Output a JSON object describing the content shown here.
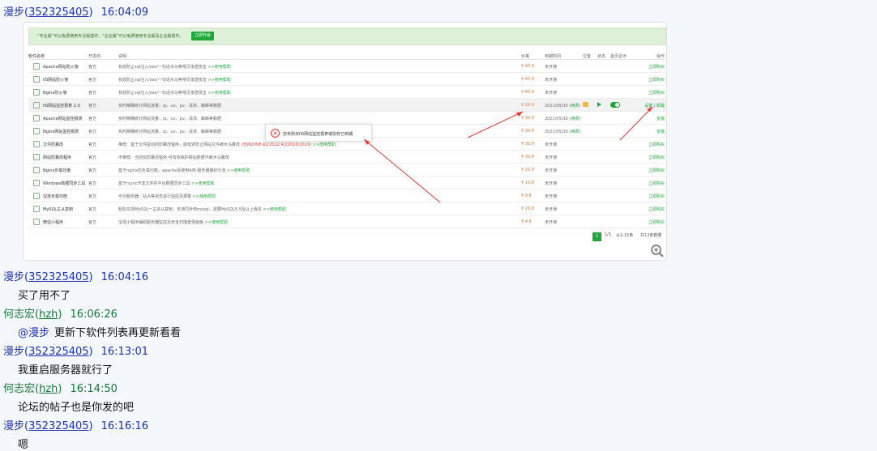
{
  "messages": [
    {
      "user": "漫步",
      "uid": "352325405",
      "time": "16:04:09",
      "color": "#1c31b6",
      "kind": "image"
    },
    {
      "user": "漫步",
      "uid": "352325405",
      "time": "16:04:16",
      "color": "#1c31b6",
      "text": "买了用不了"
    },
    {
      "user": "何志宏",
      "uid": "hzh",
      "time": "16:06:26",
      "color": "#157a35",
      "mention": "@漫步",
      "text": "更新下软件列表再更新看看"
    },
    {
      "user": "漫步",
      "uid": "352325405",
      "time": "16:13:01",
      "color": "#1c31b6",
      "text": "我重启服务器就行了"
    },
    {
      "user": "何志宏",
      "uid": "hzh",
      "time": "16:14:50",
      "color": "#157a35",
      "text": "论坛的帖子也是你发的吧"
    },
    {
      "user": "漫步",
      "uid": "352325405",
      "time": "16:16:16",
      "color": "#1c31b6",
      "text": "嗯"
    }
  ],
  "shot": {
    "banner": "“专业版”可以免费使用专业版插件，“企业版”可以免费使用专业版及企业版插件。",
    "banner_button": "立即升级",
    "headers": {
      "name": "软件名称",
      "dev": "开发商",
      "desc": "说明",
      "price": "价格",
      "expire": "到期时间",
      "pos": "位置",
      "status": "状态",
      "home": "首页显示",
      "op": "操作"
    },
    "rows": [
      {
        "name": "Apache网站防火墙",
        "dev": "官方",
        "desc": "有效防止sql注入/xss/一句话木马等常见渗透攻击",
        "more": ">>使用帮助",
        "price": "¥ 40.0",
        "expire": "未开通",
        "op": "立即购买"
      },
      {
        "name": "IIS网站防火墙",
        "dev": "官方",
        "desc": "有效防止sql注入/xss/一句话木马等常见渗透攻击",
        "more": ">>使用帮助",
        "price": "¥ 40.0",
        "expire": "未开通",
        "op": "立即购买"
      },
      {
        "name": "Nginx防火墙",
        "dev": "官方",
        "desc": "有效防止sql注入/xss/一句话木马等常见渗透攻击",
        "more": ">>使用帮助",
        "price": "¥ 40.0",
        "expire": "未开通",
        "op": "立即购买"
      },
      {
        "name": "IIS网站监控报表 2.0",
        "dev": "官方",
        "desc": "实时精确统计网站流量、ip、uv、pv、请求、蜘蛛等数据",
        "price": "¥ 20.0",
        "expire": "2021/05/30",
        "expire_link": "(续费)",
        "op": "设置 | 卸载",
        "highlight": true
      },
      {
        "name": "Apache网站监控报表",
        "dev": "官方",
        "desc": "实时精确统计网站流量、ip、uv、pv、请求、蜘蛛等数据",
        "price": "¥ 30.0",
        "expire": "2021/05/30",
        "expire_link": "(续费)",
        "op": "安装"
      },
      {
        "name": "Nginx网站监控报表",
        "dev": "官方",
        "desc": "实时精确统计网站流量、ip、uv、pv、请求、蜘蛛等数据",
        "price": "¥ 30.0",
        "expire": "2021/05/30",
        "expire_link": "(续费)",
        "op": "安装"
      },
      {
        "name": "文件防篡改",
        "dev": "官方",
        "desc": "推荐：基于文件驱动的防篡改程序，能有效防止网站文件被木马篡改",
        "red": "(支持2008 R2/2012 R2/2016/2019)",
        "more": ">>使用帮助",
        "price": "¥ 30.0",
        "expire": "未开通",
        "op": "立即购买"
      },
      {
        "name": "网站防篡改程序",
        "dev": "官方",
        "desc": "不推荐：当前仅防篡改程序,可有效保护网站数据不被木马篡改",
        "price": "¥ 30.0",
        "expire": "未开通",
        "op": "立即购买"
      },
      {
        "name": "Nginx负载均衡",
        "dev": "官方",
        "desc": "基于nginx的负载均衡，apache请使用A/B 服务器做好分流",
        "more": ">>使用帮助",
        "price": "¥ 20.0",
        "expire": "未开通",
        "op": "立即购买"
      },
      {
        "name": "Windows数据同步工具",
        "dev": "官方",
        "desc": "基于rsync开发文件的平台数据同步工具",
        "more": ">>使用帮助",
        "price": "¥ 15.0",
        "expire": "未开通",
        "op": "立即购买"
      },
      {
        "name": "宝塔负载均衡",
        "dev": "官方",
        "desc": "可对服务器、站点等状态进行监控及报警",
        "more": ">>使用帮助",
        "price": "¥ 9.8",
        "expire": "未开通",
        "op": "立即购买"
      },
      {
        "name": "MySQL主从复制",
        "dev": "官方",
        "desc": "轻松实现MySQL一主多从复制，支持同步到mssql，需要MySQL5.5及以上版本",
        "more": ">>使用帮助",
        "price": "¥ 19.8",
        "expire": "未开通",
        "op": "立即购买"
      },
      {
        "name": "微信小程序",
        "dev": "官方",
        "desc": "宝塔小程序辅助服务器监控及安全扫描登录面板",
        "more": ">>使用帮助",
        "price": "¥ 4.8",
        "expire": "未开通",
        "op": "立即购买"
      }
    ],
    "pager": {
      "current": "1",
      "pages": "1/1",
      "range": "从1-15条",
      "total": "共13条数据"
    },
    "toast": "您未购买IIS网站监控报表或授权已到期"
  }
}
